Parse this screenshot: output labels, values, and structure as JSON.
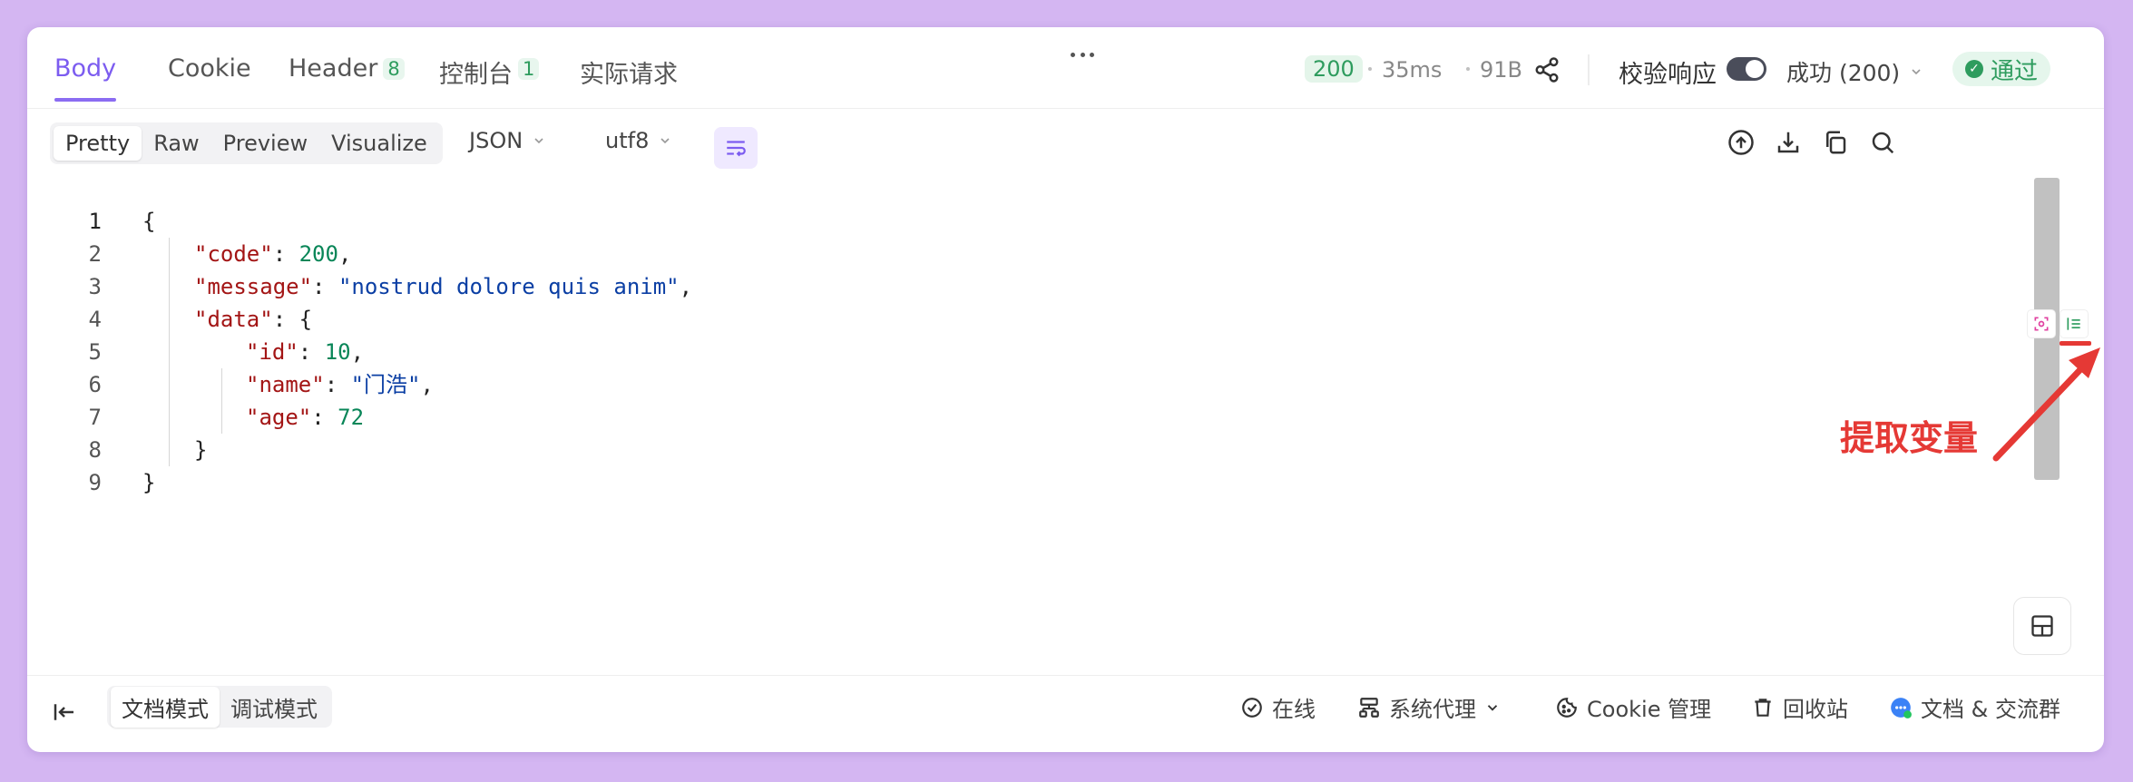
{
  "tabs": [
    {
      "label": "Body",
      "badge": ""
    },
    {
      "label": "Cookie",
      "badge": ""
    },
    {
      "label": "Header",
      "badge": "8"
    },
    {
      "label": "控制台",
      "badge": "1"
    },
    {
      "label": "实际请求",
      "badge": ""
    }
  ],
  "status": {
    "code": "200",
    "time": "35ms",
    "size": "91B",
    "validate_label": "校验响应",
    "validate_on": true,
    "result_select": "成功 (200)",
    "pass_label": "通过"
  },
  "toolbar": {
    "views": [
      "Pretty",
      "Raw",
      "Preview",
      "Visualize"
    ],
    "active_view": "Pretty",
    "format": "JSON",
    "encoding": "utf8"
  },
  "code": {
    "lines": [
      {
        "n": "1",
        "indent": 0,
        "parts": [
          [
            "p",
            "{"
          ]
        ]
      },
      {
        "n": "2",
        "indent": 1,
        "parts": [
          [
            "k",
            "\"code\""
          ],
          [
            "p",
            ": "
          ],
          [
            "n",
            "200"
          ],
          [
            "p",
            ","
          ]
        ]
      },
      {
        "n": "3",
        "indent": 1,
        "parts": [
          [
            "k",
            "\"message\""
          ],
          [
            "p",
            ": "
          ],
          [
            "s",
            "\"nostrud dolore quis anim\""
          ],
          [
            "p",
            ","
          ]
        ]
      },
      {
        "n": "4",
        "indent": 1,
        "parts": [
          [
            "k",
            "\"data\""
          ],
          [
            "p",
            ": {"
          ]
        ]
      },
      {
        "n": "5",
        "indent": 2,
        "parts": [
          [
            "k",
            "\"id\""
          ],
          [
            "p",
            ": "
          ],
          [
            "n",
            "10"
          ],
          [
            "p",
            ","
          ]
        ]
      },
      {
        "n": "6",
        "indent": 2,
        "parts": [
          [
            "k",
            "\"name\""
          ],
          [
            "p",
            ": "
          ],
          [
            "s",
            "\"门浩\""
          ],
          [
            "p",
            ","
          ]
        ]
      },
      {
        "n": "7",
        "indent": 2,
        "parts": [
          [
            "k",
            "\"age\""
          ],
          [
            "p",
            ": "
          ],
          [
            "n",
            "72"
          ]
        ]
      },
      {
        "n": "8",
        "indent": 1,
        "parts": [
          [
            "p",
            "}"
          ]
        ]
      },
      {
        "n": "9",
        "indent": 0,
        "parts": [
          [
            "p",
            "}"
          ]
        ]
      }
    ]
  },
  "annotation": {
    "text": "提取变量",
    "color": "#e53935"
  },
  "footer": {
    "modes": [
      "文档模式",
      "调试模式"
    ],
    "active_mode": "文档模式",
    "online": "在线",
    "proxy": "系统代理",
    "cookie": "Cookie 管理",
    "trash": "回收站",
    "docs": "文档 & 交流群"
  },
  "colors": {
    "accent": "#7c5cf0",
    "success": "#2e9c5e",
    "background": "#d4b6f2"
  }
}
